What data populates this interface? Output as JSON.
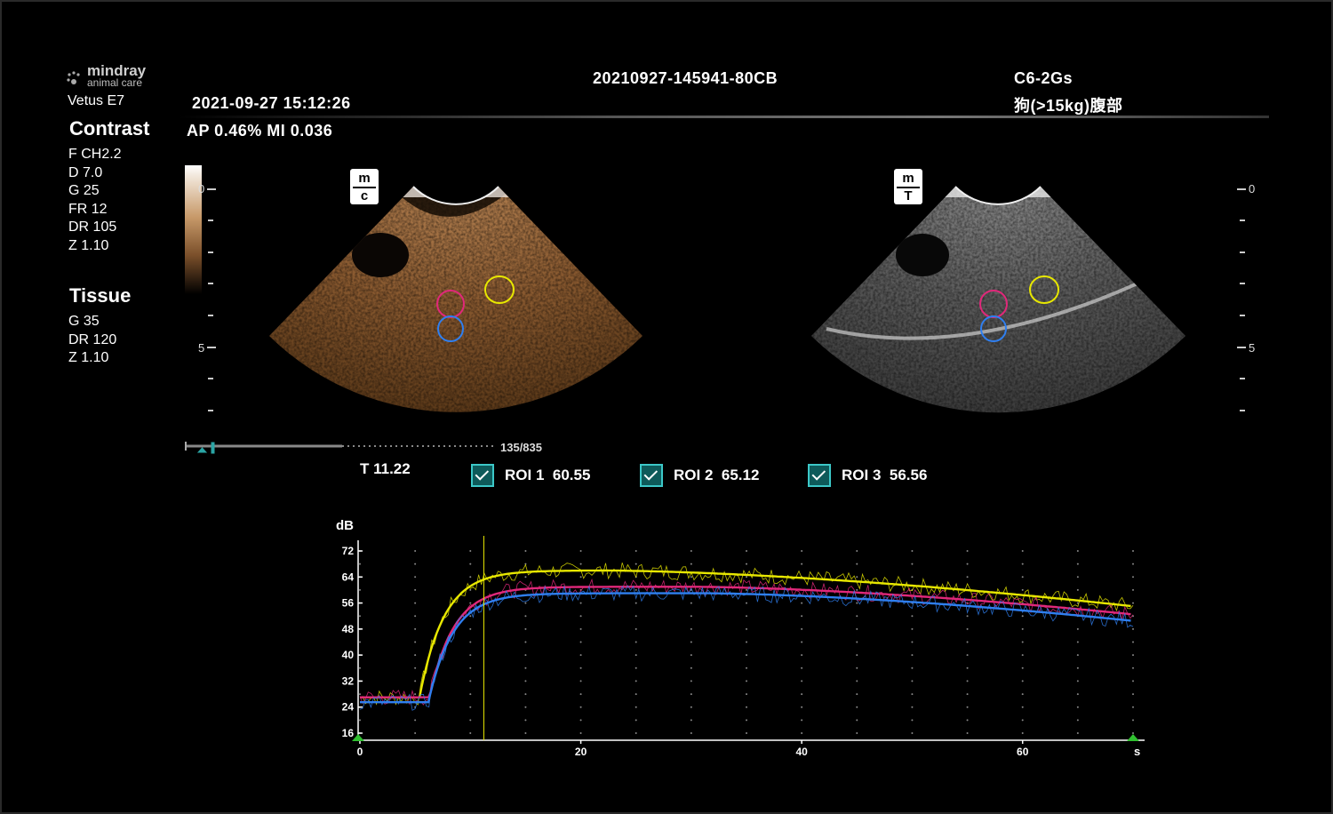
{
  "header": {
    "brand": "mindray",
    "brand_sub": "animal care",
    "model": "Vetus E7",
    "exam_id": "20210927-145941-80CB",
    "datetime": "2021-09-27   15:12:26",
    "probe": "C6-2Gs",
    "preset": "狗(>15kg)腹部",
    "acoustic": "AP 0.46%   MI 0.036"
  },
  "left_panel": {
    "contrast_title": "Contrast",
    "contrast_params": [
      "F CH2.2",
      "D 7.0",
      "G 25",
      "FR 12",
      "DR 105",
      "Z 1.10"
    ],
    "tissue_title": "Tissue",
    "tissue_params": [
      "G 35",
      "DR 120",
      "Z 1.10"
    ]
  },
  "images": {
    "contrast_badge": [
      "m",
      "c"
    ],
    "tissue_badge": [
      "m",
      "T"
    ],
    "depth_left": [
      "0",
      "5"
    ],
    "depth_right": [
      "0",
      "5"
    ]
  },
  "cine": {
    "frame": "135/835",
    "position_fraction": 0.162,
    "time": "T 11.22"
  },
  "rois": [
    {
      "label": "ROI 1",
      "value": "60.55",
      "checked": true,
      "color": "#f0f000"
    },
    {
      "label": "ROI 2",
      "value": "65.12",
      "checked": true,
      "color": "#e0287a"
    },
    {
      "label": "ROI 3",
      "value": "56.56",
      "checked": true,
      "color": "#2f7ff0"
    }
  ],
  "colors": {
    "roi1": "#e8e800",
    "roi2": "#e0287a",
    "roi3": "#2f7ff0",
    "cursor": "#e8e800",
    "marker": "#30c030"
  },
  "chart_data": {
    "type": "line",
    "ylabel": "dB",
    "xlabel": "s",
    "ylim": [
      16,
      72
    ],
    "xlim": [
      0,
      70
    ],
    "y_ticks": [
      72,
      64,
      56,
      48,
      40,
      32,
      24,
      16
    ],
    "x_ticks": [
      0,
      20,
      40,
      60
    ],
    "cursor_x": 11.22,
    "series": [
      {
        "color": "#e8e800",
        "baseline": 27,
        "peak_time": 22,
        "peak": 66,
        "end": 55,
        "rise_start": 5.4
      },
      {
        "color": "#e0287a",
        "baseline": 27,
        "peak_time": 30,
        "peak": 61,
        "end": 52.5,
        "rise_start": 6.3
      },
      {
        "color": "#2f7ff0",
        "baseline": 25.5,
        "peak_time": 31,
        "peak": 59,
        "end": 50.5,
        "rise_start": 6.2
      }
    ]
  }
}
